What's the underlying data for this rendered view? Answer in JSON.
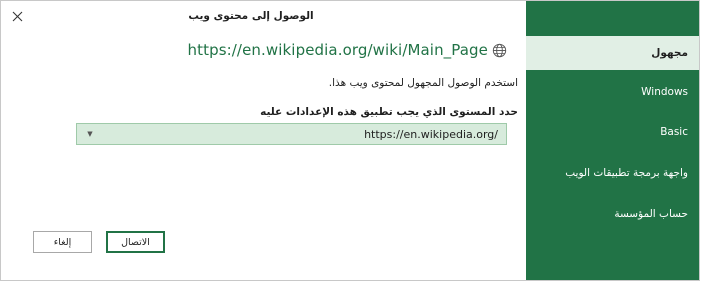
{
  "dialog": {
    "title": "الوصول إلى محتوى ويب",
    "url": "https://en.wikipedia.org/wiki/Main_Page",
    "description": "استخدم الوصول المجهول لمحتوى ويب هذا.",
    "level_label": "حدد المستوى الذي يجب تطبيق هذه الإعدادات عليه",
    "level_select_value": "https://en.wikipedia.org/",
    "connect_label": "الاتصال",
    "cancel_label": "إلغاء"
  },
  "nav": {
    "items": [
      {
        "label": "مجهول",
        "selected": true
      },
      {
        "label": "Windows",
        "selected": false
      },
      {
        "label": "Basic",
        "selected": false
      },
      {
        "label": "واجهة برمجة تطبيقات الويب",
        "selected": false
      },
      {
        "label": "حساب المؤسسة",
        "selected": false
      }
    ]
  },
  "icons": {
    "close": "close-icon",
    "globe": "globe-icon",
    "dropdown": "chevron-down-icon"
  },
  "colors": {
    "accent": "#217346",
    "selected_nav_bg": "#e1efe5",
    "select_bg": "#d7ebdc"
  }
}
